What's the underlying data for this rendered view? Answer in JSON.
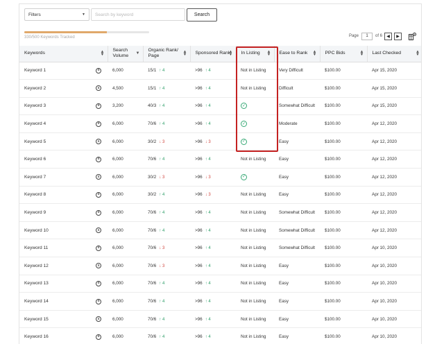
{
  "toolbar": {
    "filters_label": "Filters",
    "search_placeholder": "Search by keyword",
    "search_button": "Search"
  },
  "progress": {
    "label": "330/500 Keywords Tracked",
    "fraction": 0.66
  },
  "pager": {
    "page_label": "Page",
    "current_page": "1",
    "of_label": "of 6",
    "prev": "◀",
    "next": "▶"
  },
  "columns": [
    "Keywords",
    "Search Volume",
    "Organic Rank/ Page",
    "Sponsored Rank",
    "In Listing",
    "Ease to Rank",
    "PPC Bids",
    "Last Checked"
  ],
  "rows": [
    {
      "keyword": "Keyword 1",
      "volume": "6,000",
      "organic": "15/1",
      "organic_dir": "up",
      "organic_delta": "4",
      "sponsored": ">96",
      "sponsored_dir": "up",
      "sponsored_delta": "4",
      "in_listing": "Not in Listing",
      "ease": "Very Difficult",
      "ppc": "$100.00",
      "checked": "Apr 15, 2020"
    },
    {
      "keyword": "Keyword 2",
      "volume": "4,500",
      "organic": "15/1",
      "organic_dir": "up",
      "organic_delta": "4",
      "sponsored": ">96",
      "sponsored_dir": "up",
      "sponsored_delta": "4",
      "in_listing": "Not in Listing",
      "ease": "Difficult",
      "ppc": "$100.00",
      "checked": "Apr 15, 2020"
    },
    {
      "keyword": "Keyword 3",
      "volume": "3,200",
      "organic": "40/3",
      "organic_dir": "up",
      "organic_delta": "4",
      "sponsored": ">96",
      "sponsored_dir": "up",
      "sponsored_delta": "4",
      "in_listing": "check",
      "ease": "Somewhat Difficult",
      "ppc": "$100.00",
      "checked": "Apr 15, 2020"
    },
    {
      "keyword": "Keyword 4",
      "volume": "6,000",
      "organic": "70/6",
      "organic_dir": "up",
      "organic_delta": "4",
      "sponsored": ">96",
      "sponsored_dir": "up",
      "sponsored_delta": "4",
      "in_listing": "check",
      "ease": "Moderate",
      "ppc": "$100.00",
      "checked": "Apr 12, 2020"
    },
    {
      "keyword": "Keyword 5",
      "volume": "6,000",
      "organic": "30/2",
      "organic_dir": "down",
      "organic_delta": "3",
      "sponsored": ">96",
      "sponsored_dir": "down",
      "sponsored_delta": "3",
      "in_listing": "check",
      "ease": "Easy",
      "ppc": "$100.00",
      "checked": "Apr 12, 2020"
    },
    {
      "keyword": "Keyword 6",
      "volume": "6,000",
      "organic": "70/6",
      "organic_dir": "up",
      "organic_delta": "4",
      "sponsored": ">96",
      "sponsored_dir": "up",
      "sponsored_delta": "4",
      "in_listing": "Not in Listing",
      "ease": "Easy",
      "ppc": "$100.00",
      "checked": "Apr 12, 2020"
    },
    {
      "keyword": "Keyword 7",
      "volume": "6,000",
      "organic": "30/2",
      "organic_dir": "down",
      "organic_delta": "3",
      "sponsored": ">96",
      "sponsored_dir": "down",
      "sponsored_delta": "3",
      "in_listing": "check",
      "ease": "Easy",
      "ppc": "$100.00",
      "checked": "Apr 12, 2020"
    },
    {
      "keyword": "Keyword 8",
      "volume": "6,000",
      "organic": "30/2",
      "organic_dir": "up",
      "organic_delta": "4",
      "sponsored": ">96",
      "sponsored_dir": "down",
      "sponsored_delta": "3",
      "in_listing": "Not in Listing",
      "ease": "Easy",
      "ppc": "$100.00",
      "checked": "Apr 12, 2020"
    },
    {
      "keyword": "Keyword 9",
      "volume": "6,000",
      "organic": "70/6",
      "organic_dir": "up",
      "organic_delta": "4",
      "sponsored": ">96",
      "sponsored_dir": "up",
      "sponsored_delta": "4",
      "in_listing": "Not in Listing",
      "ease": "Somewhat Difficult",
      "ppc": "$100.00",
      "checked": "Apr 12, 2020"
    },
    {
      "keyword": "Keyword 10",
      "volume": "6,000",
      "organic": "70/6",
      "organic_dir": "up",
      "organic_delta": "4",
      "sponsored": ">96",
      "sponsored_dir": "up",
      "sponsored_delta": "4",
      "in_listing": "Not in Listing",
      "ease": "Somewhat Difficult",
      "ppc": "$100.00",
      "checked": "Apr 12, 2020"
    },
    {
      "keyword": "Keyword 11",
      "volume": "6,000",
      "organic": "70/6",
      "organic_dir": "down",
      "organic_delta": "3",
      "sponsored": ">96",
      "sponsored_dir": "up",
      "sponsored_delta": "4",
      "in_listing": "Not in Listing",
      "ease": "Somewhat Difficult",
      "ppc": "$100.00",
      "checked": "Apr 10, 2020"
    },
    {
      "keyword": "Keyword 12",
      "volume": "6,000",
      "organic": "70/6",
      "organic_dir": "down",
      "organic_delta": "3",
      "sponsored": ">96",
      "sponsored_dir": "up",
      "sponsored_delta": "4",
      "in_listing": "Not in Listing",
      "ease": "Easy",
      "ppc": "$100.00",
      "checked": "Apr 10, 2020"
    },
    {
      "keyword": "Keyword 13",
      "volume": "6,000",
      "organic": "70/6",
      "organic_dir": "up",
      "organic_delta": "4",
      "sponsored": ">96",
      "sponsored_dir": "up",
      "sponsored_delta": "4",
      "in_listing": "Not in Listing",
      "ease": "Easy",
      "ppc": "$100.00",
      "checked": "Apr 10, 2020"
    },
    {
      "keyword": "Keyword 14",
      "volume": "6,000",
      "organic": "70/6",
      "organic_dir": "up",
      "organic_delta": "4",
      "sponsored": ">96",
      "sponsored_dir": "up",
      "sponsored_delta": "4",
      "in_listing": "Not in Listing",
      "ease": "Easy",
      "ppc": "$100.00",
      "checked": "Apr 10, 2020"
    },
    {
      "keyword": "Keyword 15",
      "volume": "6,000",
      "organic": "70/6",
      "organic_dir": "up",
      "organic_delta": "4",
      "sponsored": ">96",
      "sponsored_dir": "up",
      "sponsored_delta": "4",
      "in_listing": "Not in Listing",
      "ease": "Easy",
      "ppc": "$100.00",
      "checked": "Apr 10, 2020"
    },
    {
      "keyword": "Keyword 16",
      "volume": "6,000",
      "organic": "70/6",
      "organic_dir": "up",
      "organic_delta": "4",
      "sponsored": ">96",
      "sponsored_dir": "up",
      "sponsored_delta": "4",
      "in_listing": "Not in Listing",
      "ease": "Easy",
      "ppc": "$100.00",
      "checked": "Apr 10, 2020"
    }
  ],
  "colors": {
    "up": "#2e9e68",
    "down": "#d0443d",
    "highlight": "#c42121",
    "progress": "#e0a86a"
  }
}
